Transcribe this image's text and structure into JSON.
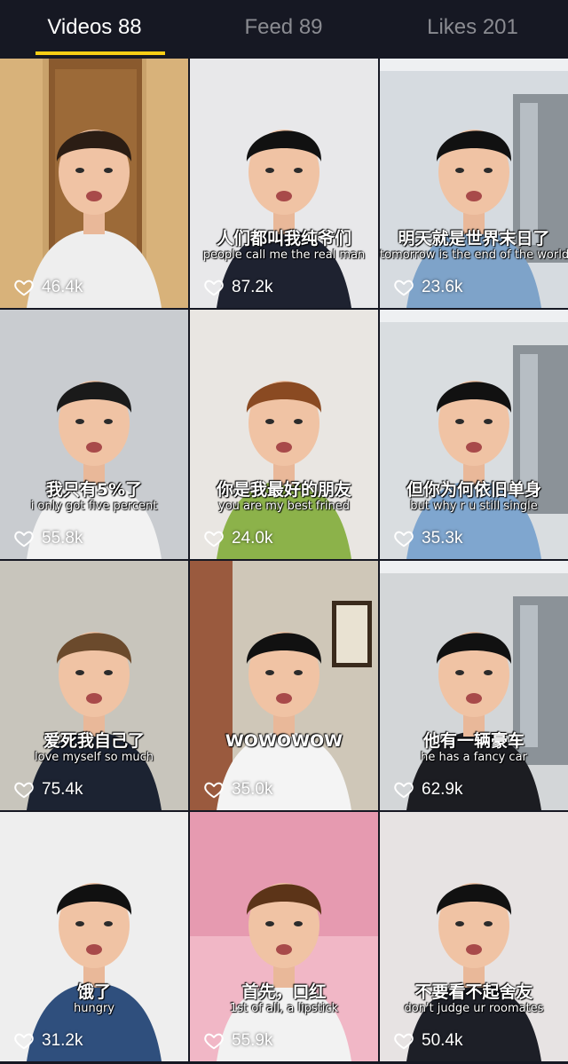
{
  "tabs": [
    {
      "label": "Videos 88",
      "active": true
    },
    {
      "label": "Feed 89",
      "active": false
    },
    {
      "label": "Likes 201",
      "active": false
    }
  ],
  "accent_color": "#face15",
  "heart_icon": "heart-outline-icon",
  "videos": [
    {
      "likes": "46.4k",
      "caption_zh": "",
      "caption_en": "",
      "scene": "doorway",
      "bg": "#c19a63",
      "shirt": "#eeeeee",
      "hair": "#2b1d14"
    },
    {
      "likes": "87.2k",
      "caption_zh": "人们都叫我纯爷们",
      "caption_en": "people call me the real man",
      "scene": "white",
      "bg": "#e8e8ea",
      "shirt": "#1e2230",
      "hair": "#111111"
    },
    {
      "likes": "23.6k",
      "caption_zh": "明天就是世界末日了",
      "caption_en": "tomorrow is the end of the world",
      "scene": "office",
      "bg": "#d6dbe0",
      "shirt": "#7ea3c9",
      "hair": "#111111"
    },
    {
      "likes": "55.8k",
      "caption_zh": "我只有5%了",
      "caption_en": "i only got five percent",
      "scene": "white",
      "bg": "#c9ccd0",
      "shirt": "#f2f2f2",
      "hair": "#1a1a1a"
    },
    {
      "likes": "24.0k",
      "caption_zh": "你是我最好的朋友",
      "caption_en": "you are my best frined",
      "scene": "white",
      "bg": "#e9e6e2",
      "shirt": "#8cb24a",
      "hair": "#8a4a22"
    },
    {
      "likes": "35.3k",
      "caption_zh": "但你为何依旧单身",
      "caption_en": "but why r u still single",
      "scene": "office",
      "bg": "#d9dde0",
      "shirt": "#7fa6cf",
      "hair": "#111111"
    },
    {
      "likes": "75.4k",
      "caption_zh": "爱死我自己了",
      "caption_en": "love myself so much",
      "scene": "white",
      "bg": "#c8c5bc",
      "shirt": "#1c2332",
      "hair": "#6b4a2c"
    },
    {
      "likes": "35.0k",
      "caption_zh": "",
      "caption_en": "WOWOWOW",
      "scene": "room",
      "bg": "#d8d4cc",
      "shirt": "#f4f4f4",
      "hair": "#111111"
    },
    {
      "likes": "62.9k",
      "caption_zh": "他有一辆豪车",
      "caption_en": "he has a fancy car",
      "scene": "office",
      "bg": "#d3d6d8",
      "shirt": "#1c1d22",
      "hair": "#111111"
    },
    {
      "likes": "31.2k",
      "caption_zh": "饿了",
      "caption_en": "hungry",
      "scene": "white",
      "bg": "#eeeeee",
      "shirt": "#2f4f7d",
      "hair": "#111111"
    },
    {
      "likes": "55.9k",
      "caption_zh": "首先，口红",
      "caption_en": "1st of all, a lipstick",
      "scene": "pink",
      "bg": "#e9a8ba",
      "shirt": "#f2f2f2",
      "hair": "#5c3418"
    },
    {
      "likes": "50.4k",
      "caption_zh": "不要看不起舍友",
      "caption_en": "don't judge ur roomates",
      "scene": "white",
      "bg": "#e7e3e3",
      "shirt": "#1d1f27",
      "hair": "#111111"
    }
  ]
}
